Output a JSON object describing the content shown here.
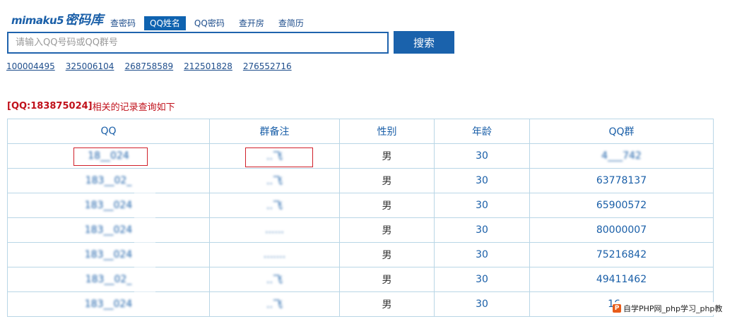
{
  "logo": {
    "latin": "mimaku5",
    "cjk": "密码库"
  },
  "nav": [
    {
      "label": "查密码",
      "active": false
    },
    {
      "label": "QQ姓名",
      "active": true
    },
    {
      "label": "QQ密码",
      "active": false
    },
    {
      "label": "查开房",
      "active": false
    },
    {
      "label": "查简历",
      "active": false
    }
  ],
  "search": {
    "placeholder": "请输入QQ号码或QQ群号",
    "value": "",
    "button_label": "搜索"
  },
  "quick_links": [
    "100004495",
    "325006104",
    "268758589",
    "212501828",
    "276552716"
  ],
  "result_title": {
    "open": "[ ",
    "qq_label": "QQ:183875024",
    "close": " ]",
    "suffix": "相关的记录查询如下"
  },
  "table": {
    "headers": [
      "QQ",
      "群备注",
      "性别",
      "年龄",
      "QQ群"
    ],
    "rows": [
      {
        "qq": "18__024",
        "note": "..飞",
        "gender": "男",
        "age": "30",
        "group": "4___742",
        "highlighted": true,
        "blur_group": true
      },
      {
        "qq": "183__02_",
        "note": "..飞",
        "gender": "男",
        "age": "30",
        "group": "63778137",
        "highlighted": false,
        "blur_group": false
      },
      {
        "qq": "183__024",
        "note": "..飞",
        "gender": "男",
        "age": "30",
        "group": "65900572",
        "highlighted": false,
        "blur_group": false
      },
      {
        "qq": "183__024",
        "note": "......",
        "gender": "男",
        "age": "30",
        "group": "80000007",
        "highlighted": false,
        "blur_group": false
      },
      {
        "qq": "183__024",
        "note": ".......",
        "gender": "男",
        "age": "30",
        "group": "75216842",
        "highlighted": false,
        "blur_group": false
      },
      {
        "qq": "183__02_",
        "note": "..飞",
        "gender": "男",
        "age": "30",
        "group": "49411462",
        "highlighted": false,
        "blur_group": false
      },
      {
        "qq": "183__024",
        "note": "..飞",
        "gender": "男",
        "age": "30",
        "group": "16___",
        "highlighted": false,
        "blur_group": false
      }
    ]
  },
  "watermark": {
    "text": "自学PHP网_php学习_php教"
  },
  "colors": {
    "brand_blue": "#1a62ac",
    "link_blue": "#1f4e8c",
    "title_red": "#c0101a",
    "border": "#b9d6e6"
  }
}
